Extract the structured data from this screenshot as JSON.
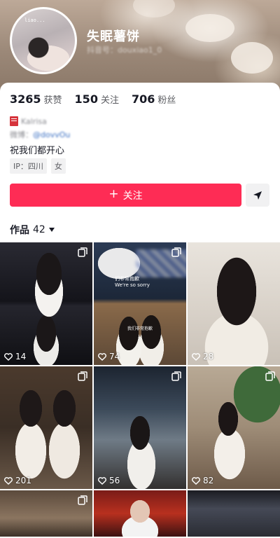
{
  "profile": {
    "nickname": "失眠薯饼",
    "user_id": "抖音号：douxiao1_0",
    "avatar_tag": "liao..."
  },
  "stats": [
    {
      "value": "3265",
      "label": "获赞"
    },
    {
      "value": "150",
      "label": "关注"
    },
    {
      "value": "706",
      "label": "粉丝"
    }
  ],
  "bio": {
    "line1": "Kalrisa",
    "line2_prefix": "微博：",
    "line2_handle": "@dovvOu",
    "signature": "祝我们都开心"
  },
  "tags": [
    "IP：四川",
    "女"
  ],
  "actions": {
    "follow_label": "关注",
    "follow_plus": "+"
  },
  "works": {
    "label": "作品",
    "count": "42"
  },
  "grid": {
    "tiles": [
      {
        "likes": "14",
        "multi": true
      },
      {
        "likes": "74",
        "multi": true,
        "caption_cn": "们非常抱歉",
        "caption_en": "We're so sorry",
        "caption_small": "我们非常抱歉"
      },
      {
        "likes": "28",
        "multi": false
      },
      {
        "likes": "201",
        "multi": true
      },
      {
        "likes": "56",
        "multi": true
      },
      {
        "likes": "82",
        "multi": true
      },
      {
        "likes": "",
        "multi": true
      },
      {
        "likes": "",
        "multi": false
      },
      {
        "likes": "",
        "multi": false
      }
    ]
  },
  "colors": {
    "accent": "#fe2c55",
    "text_primary": "#161823",
    "text_secondary": "#5b5c61",
    "chip_bg": "#f1f1f2"
  }
}
